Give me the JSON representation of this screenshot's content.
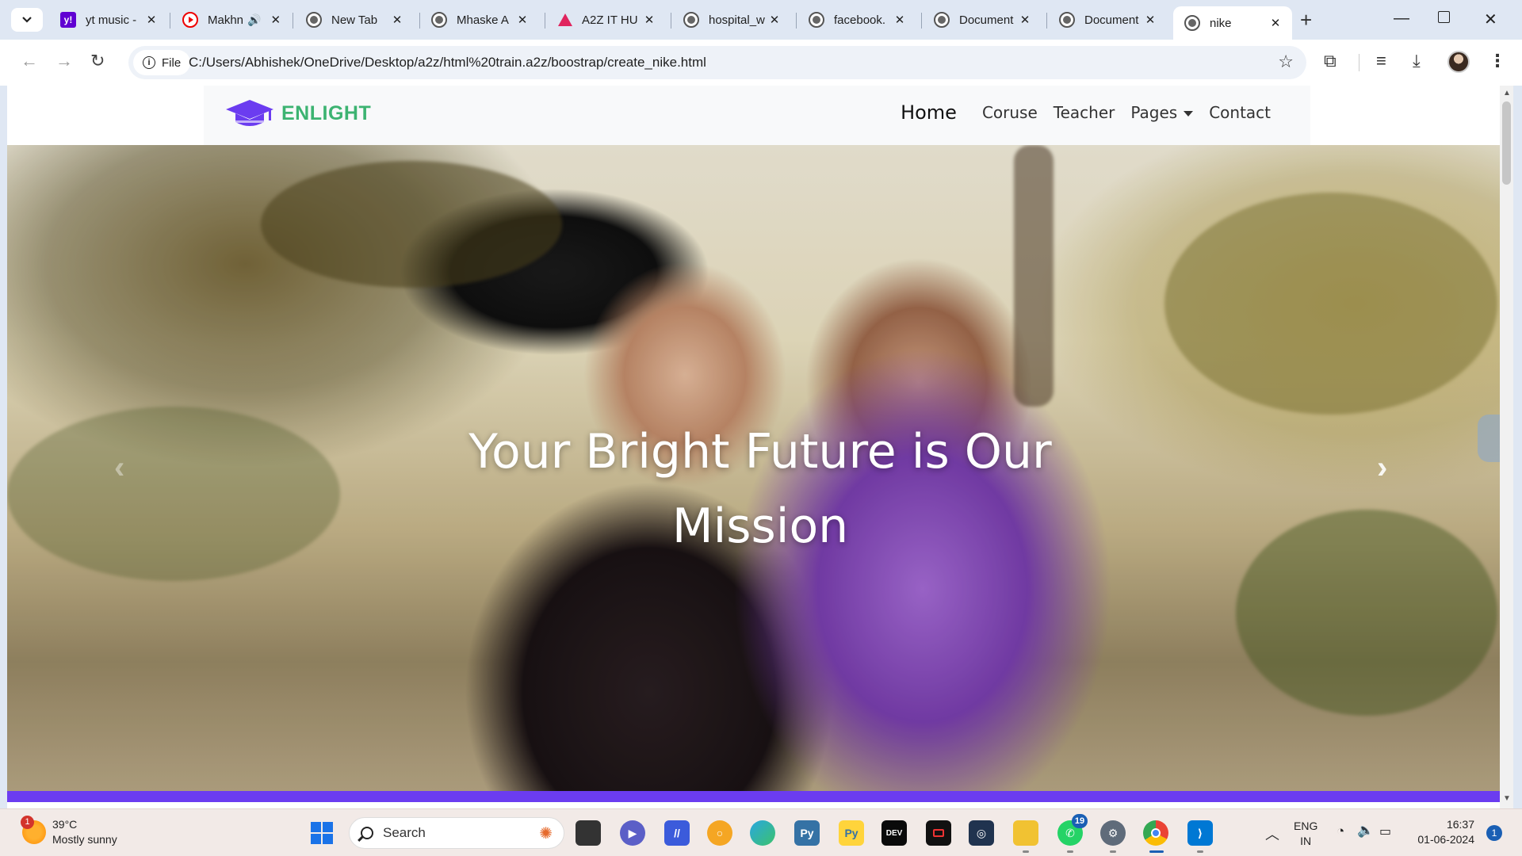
{
  "browser": {
    "tabs": [
      {
        "title": "yt music -",
        "favicon": "yahoo-icon",
        "color": "#6001d2"
      },
      {
        "title": "Makhn",
        "favicon": "youtube-icon",
        "color": "#ff0000",
        "audio": true
      },
      {
        "title": "New Tab",
        "favicon": "globe-icon"
      },
      {
        "title": "Mhaske A",
        "favicon": "globe-icon"
      },
      {
        "title": "A2Z IT HU",
        "favicon": "a2z-icon",
        "color": "#e0245e"
      },
      {
        "title": "hospital_w",
        "favicon": "globe-icon"
      },
      {
        "title": "facebook.",
        "favicon": "globe-icon"
      },
      {
        "title": "Document",
        "favicon": "globe-icon"
      },
      {
        "title": "Document",
        "favicon": "globe-icon"
      },
      {
        "title": "nike",
        "favicon": "globe-icon",
        "active": true
      }
    ],
    "chip_label": "File",
    "url": "C:/Users/Abhishek/OneDrive/Desktop/a2z/html%20train.a2z/boostrap/create_nike.html"
  },
  "page": {
    "brand": {
      "name": "ENLIGHT",
      "color": "#3cb371",
      "logo_color": "#6b3cf0"
    },
    "nav": {
      "home": "Home",
      "course": "Coruse",
      "teacher": "Teacher",
      "pages": "Pages",
      "contact": "Contact"
    },
    "hero": {
      "line1": "Your Bright Future is Our",
      "line2": "Mission",
      "accent_color": "#6b3cf0"
    }
  },
  "taskbar": {
    "weather": {
      "temp": "39°C",
      "desc": "Mostly sunny",
      "badge": "1"
    },
    "search_label": "Search",
    "whatsapp_badge": "19",
    "lang_line1": "ENG",
    "lang_line2": "IN",
    "time": "16:37",
    "date": "01-06-2024",
    "notification_count": "1"
  }
}
